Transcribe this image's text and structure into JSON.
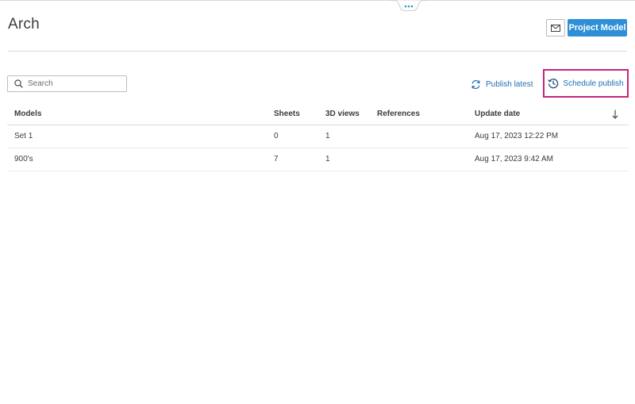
{
  "header": {
    "title": "Arch",
    "mail_icon": "envelope-icon",
    "project_model_label": "Project Model"
  },
  "toolbar": {
    "search_placeholder": "Search",
    "search_value": "",
    "search_icon": "search-icon",
    "publish_latest_label": "Publish latest",
    "publish_latest_icon": "refresh-icon",
    "schedule_publish_label": "Schedule publish",
    "schedule_publish_icon": "history-clock-icon"
  },
  "table": {
    "columns": [
      "Models",
      "Sheets",
      "3D views",
      "References",
      "Update date"
    ],
    "sort_icon": "arrow-down-icon",
    "rows": [
      {
        "model": "Set 1",
        "sheets": "0",
        "views": "1",
        "references": "",
        "update_date": "Aug 17, 2023 12:22 PM"
      },
      {
        "model": "900's",
        "sheets": "7",
        "views": "1",
        "references": "",
        "update_date": "Aug 17, 2023 9:42 AM"
      }
    ]
  },
  "colors": {
    "primary": "#2d8fd6",
    "link": "#1f6fb5",
    "highlight_border": "#c5267a",
    "handle_dots": "#2aa0c8"
  }
}
